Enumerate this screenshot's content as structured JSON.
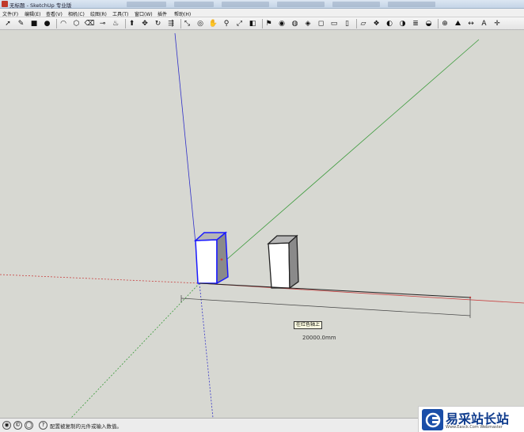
{
  "window": {
    "title": "无标题 - SketchUp 专业版",
    "background_tabs": [
      "",
      "",
      "",
      "",
      "",
      ""
    ]
  },
  "menubar": {
    "items": [
      "文件(F)",
      "编辑(E)",
      "查看(V)",
      "相机(C)",
      "绘图(R)",
      "工具(T)",
      "窗口(W)",
      "插件",
      "帮助(H)"
    ]
  },
  "toolbar": {
    "tools": [
      {
        "name": "select-icon",
        "glyph": "➚"
      },
      {
        "name": "pencil-icon",
        "glyph": "✎"
      },
      {
        "name": "rectangle-icon",
        "glyph": "■"
      },
      {
        "name": "circle-icon",
        "glyph": "●"
      },
      {
        "name": "arc-icon",
        "glyph": "◠"
      },
      {
        "name": "polygon-icon",
        "glyph": "⬡"
      },
      {
        "name": "eraser-icon",
        "glyph": "⌫"
      },
      {
        "name": "tape-measure-icon",
        "glyph": "⊸"
      },
      {
        "name": "paint-bucket-icon",
        "glyph": "♨"
      },
      {
        "name": "push-pull-icon",
        "glyph": "⬆"
      },
      {
        "name": "move-icon",
        "glyph": "✥"
      },
      {
        "name": "rotate-icon",
        "glyph": "↻"
      },
      {
        "name": "follow-me-icon",
        "glyph": "⇶"
      },
      {
        "name": "scale-icon",
        "glyph": "⤡"
      },
      {
        "name": "orbit-icon",
        "glyph": "◎"
      },
      {
        "name": "pan-icon",
        "glyph": "✋"
      },
      {
        "name": "zoom-icon",
        "glyph": "⚲"
      },
      {
        "name": "zoom-extents-icon",
        "glyph": "⤢"
      },
      {
        "name": "previous-view-icon",
        "glyph": "◧"
      },
      {
        "name": "walk-icon",
        "glyph": "⚑"
      },
      {
        "name": "position-camera-icon",
        "glyph": "◉"
      },
      {
        "name": "look-around-icon",
        "glyph": "◍"
      },
      {
        "name": "iso-view-icon",
        "glyph": "◈"
      },
      {
        "name": "top-view-icon",
        "glyph": "◻"
      },
      {
        "name": "front-view-icon",
        "glyph": "▭"
      },
      {
        "name": "right-view-icon",
        "glyph": "▯"
      },
      {
        "name": "back-view-icon",
        "glyph": "▱"
      },
      {
        "name": "components-icon",
        "glyph": "❖"
      },
      {
        "name": "materials-icon",
        "glyph": "◐"
      },
      {
        "name": "styles-icon",
        "glyph": "◑"
      },
      {
        "name": "layers-icon",
        "glyph": "≣"
      },
      {
        "name": "shadows-icon",
        "glyph": "◒"
      },
      {
        "name": "section-icon",
        "glyph": "⊕"
      },
      {
        "name": "sandbox-icon",
        "glyph": "⛰"
      },
      {
        "name": "dimension-icon",
        "glyph": "↔"
      },
      {
        "name": "text-icon",
        "glyph": "A"
      },
      {
        "name": "axes-icon",
        "glyph": "✛"
      }
    ]
  },
  "viewport": {
    "tooltip": "在红色轴上",
    "dimension_label": "20000.0mm"
  },
  "statusbar": {
    "icons": [
      {
        "name": "geo-location-icon",
        "glyph": "◉"
      },
      {
        "name": "credits-icon",
        "glyph": "©"
      },
      {
        "name": "user-icon",
        "glyph": "◯"
      },
      {
        "name": "help-icon",
        "glyph": "?"
      }
    ],
    "text": "配置被复制的元件或输入数值。"
  },
  "watermark": {
    "name": "易采站长站",
    "url": "Www.Easck.Com  Webmaster"
  },
  "colors": {
    "red_axis": "#c84040",
    "green_axis": "#3a9a3a",
    "blue_axis": "#3030c8",
    "selection": "#1a1aff",
    "background": "#d7d8d2"
  }
}
